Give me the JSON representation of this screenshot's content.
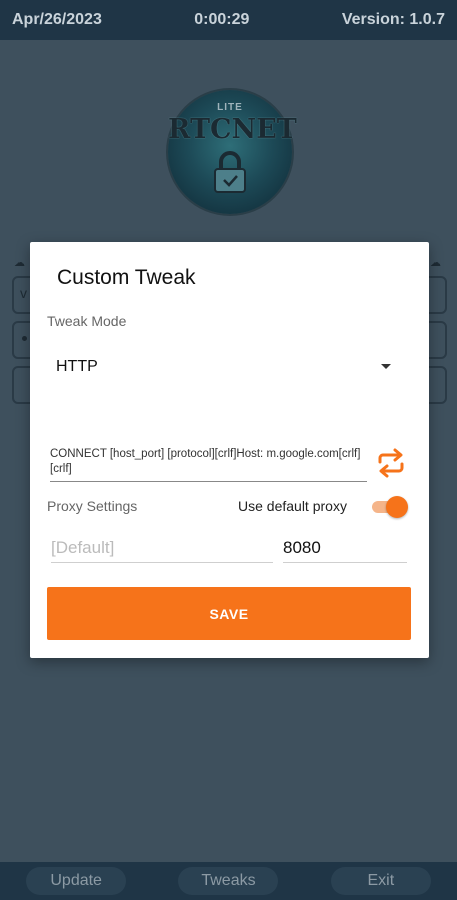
{
  "status_bar": {
    "date": "Apr/26/2023",
    "time": "0:00:29",
    "version": "Version: 1.0.7"
  },
  "logo": {
    "lite": "LITE",
    "brand": "RTCNET"
  },
  "background": {
    "field_first_char": "v"
  },
  "dialog": {
    "title": "Custom Tweak",
    "tweak_mode_label": "Tweak Mode",
    "tweak_mode_value": "HTTP",
    "payload": "CONNECT [host_port] [protocol][crlf]Host: m.google.com[crlf][crlf]",
    "proxy_settings_label": "Proxy Settings",
    "use_default_proxy_label": "Use default proxy",
    "use_default_proxy_on": true,
    "proxy_host_placeholder": "[Default]",
    "proxy_port_value": "8080",
    "save_label": "SAVE"
  },
  "bottom_nav": {
    "update": "Update",
    "tweaks": "Tweaks",
    "exit": "Exit"
  },
  "colors": {
    "accent": "#f6731a",
    "overlay_bg": "#3e505d",
    "bar_bg": "#1f3546"
  }
}
